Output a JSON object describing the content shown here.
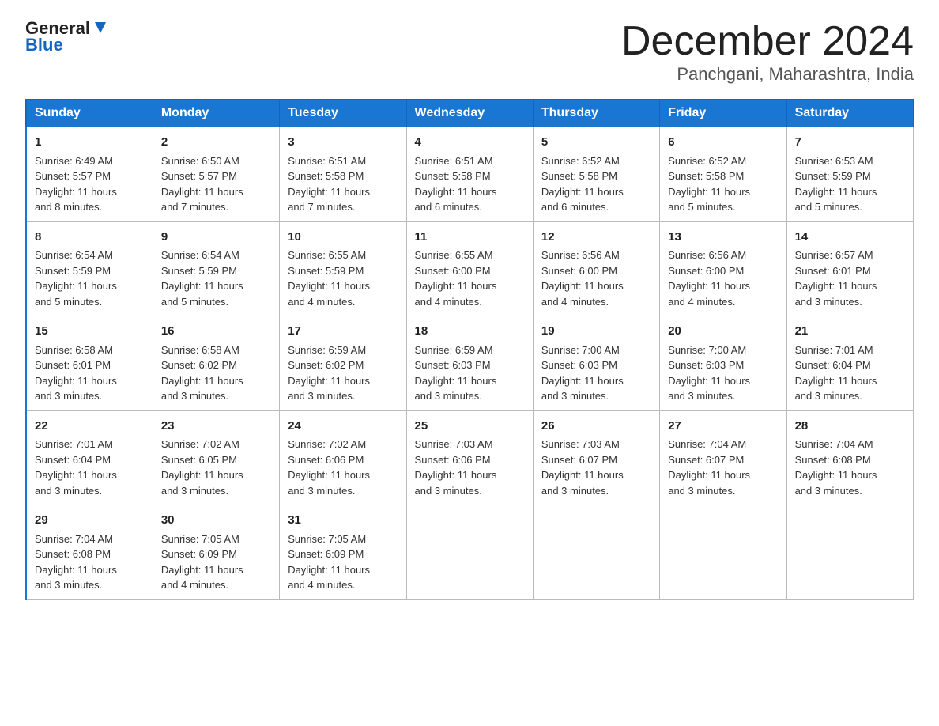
{
  "header": {
    "logo_line1": "General",
    "logo_arrow": true,
    "logo_line2": "Blue",
    "month_title": "December 2024",
    "location": "Panchgani, Maharashtra, India"
  },
  "days_of_week": [
    "Sunday",
    "Monday",
    "Tuesday",
    "Wednesday",
    "Thursday",
    "Friday",
    "Saturday"
  ],
  "weeks": [
    [
      {
        "day": "1",
        "info": "Sunrise: 6:49 AM\nSunset: 5:57 PM\nDaylight: 11 hours\nand 8 minutes."
      },
      {
        "day": "2",
        "info": "Sunrise: 6:50 AM\nSunset: 5:57 PM\nDaylight: 11 hours\nand 7 minutes."
      },
      {
        "day": "3",
        "info": "Sunrise: 6:51 AM\nSunset: 5:58 PM\nDaylight: 11 hours\nand 7 minutes."
      },
      {
        "day": "4",
        "info": "Sunrise: 6:51 AM\nSunset: 5:58 PM\nDaylight: 11 hours\nand 6 minutes."
      },
      {
        "day": "5",
        "info": "Sunrise: 6:52 AM\nSunset: 5:58 PM\nDaylight: 11 hours\nand 6 minutes."
      },
      {
        "day": "6",
        "info": "Sunrise: 6:52 AM\nSunset: 5:58 PM\nDaylight: 11 hours\nand 5 minutes."
      },
      {
        "day": "7",
        "info": "Sunrise: 6:53 AM\nSunset: 5:59 PM\nDaylight: 11 hours\nand 5 minutes."
      }
    ],
    [
      {
        "day": "8",
        "info": "Sunrise: 6:54 AM\nSunset: 5:59 PM\nDaylight: 11 hours\nand 5 minutes."
      },
      {
        "day": "9",
        "info": "Sunrise: 6:54 AM\nSunset: 5:59 PM\nDaylight: 11 hours\nand 5 minutes."
      },
      {
        "day": "10",
        "info": "Sunrise: 6:55 AM\nSunset: 5:59 PM\nDaylight: 11 hours\nand 4 minutes."
      },
      {
        "day": "11",
        "info": "Sunrise: 6:55 AM\nSunset: 6:00 PM\nDaylight: 11 hours\nand 4 minutes."
      },
      {
        "day": "12",
        "info": "Sunrise: 6:56 AM\nSunset: 6:00 PM\nDaylight: 11 hours\nand 4 minutes."
      },
      {
        "day": "13",
        "info": "Sunrise: 6:56 AM\nSunset: 6:00 PM\nDaylight: 11 hours\nand 4 minutes."
      },
      {
        "day": "14",
        "info": "Sunrise: 6:57 AM\nSunset: 6:01 PM\nDaylight: 11 hours\nand 3 minutes."
      }
    ],
    [
      {
        "day": "15",
        "info": "Sunrise: 6:58 AM\nSunset: 6:01 PM\nDaylight: 11 hours\nand 3 minutes."
      },
      {
        "day": "16",
        "info": "Sunrise: 6:58 AM\nSunset: 6:02 PM\nDaylight: 11 hours\nand 3 minutes."
      },
      {
        "day": "17",
        "info": "Sunrise: 6:59 AM\nSunset: 6:02 PM\nDaylight: 11 hours\nand 3 minutes."
      },
      {
        "day": "18",
        "info": "Sunrise: 6:59 AM\nSunset: 6:03 PM\nDaylight: 11 hours\nand 3 minutes."
      },
      {
        "day": "19",
        "info": "Sunrise: 7:00 AM\nSunset: 6:03 PM\nDaylight: 11 hours\nand 3 minutes."
      },
      {
        "day": "20",
        "info": "Sunrise: 7:00 AM\nSunset: 6:03 PM\nDaylight: 11 hours\nand 3 minutes."
      },
      {
        "day": "21",
        "info": "Sunrise: 7:01 AM\nSunset: 6:04 PM\nDaylight: 11 hours\nand 3 minutes."
      }
    ],
    [
      {
        "day": "22",
        "info": "Sunrise: 7:01 AM\nSunset: 6:04 PM\nDaylight: 11 hours\nand 3 minutes."
      },
      {
        "day": "23",
        "info": "Sunrise: 7:02 AM\nSunset: 6:05 PM\nDaylight: 11 hours\nand 3 minutes."
      },
      {
        "day": "24",
        "info": "Sunrise: 7:02 AM\nSunset: 6:06 PM\nDaylight: 11 hours\nand 3 minutes."
      },
      {
        "day": "25",
        "info": "Sunrise: 7:03 AM\nSunset: 6:06 PM\nDaylight: 11 hours\nand 3 minutes."
      },
      {
        "day": "26",
        "info": "Sunrise: 7:03 AM\nSunset: 6:07 PM\nDaylight: 11 hours\nand 3 minutes."
      },
      {
        "day": "27",
        "info": "Sunrise: 7:04 AM\nSunset: 6:07 PM\nDaylight: 11 hours\nand 3 minutes."
      },
      {
        "day": "28",
        "info": "Sunrise: 7:04 AM\nSunset: 6:08 PM\nDaylight: 11 hours\nand 3 minutes."
      }
    ],
    [
      {
        "day": "29",
        "info": "Sunrise: 7:04 AM\nSunset: 6:08 PM\nDaylight: 11 hours\nand 3 minutes."
      },
      {
        "day": "30",
        "info": "Sunrise: 7:05 AM\nSunset: 6:09 PM\nDaylight: 11 hours\nand 4 minutes."
      },
      {
        "day": "31",
        "info": "Sunrise: 7:05 AM\nSunset: 6:09 PM\nDaylight: 11 hours\nand 4 minutes."
      },
      {
        "day": "",
        "info": ""
      },
      {
        "day": "",
        "info": ""
      },
      {
        "day": "",
        "info": ""
      },
      {
        "day": "",
        "info": ""
      }
    ]
  ]
}
